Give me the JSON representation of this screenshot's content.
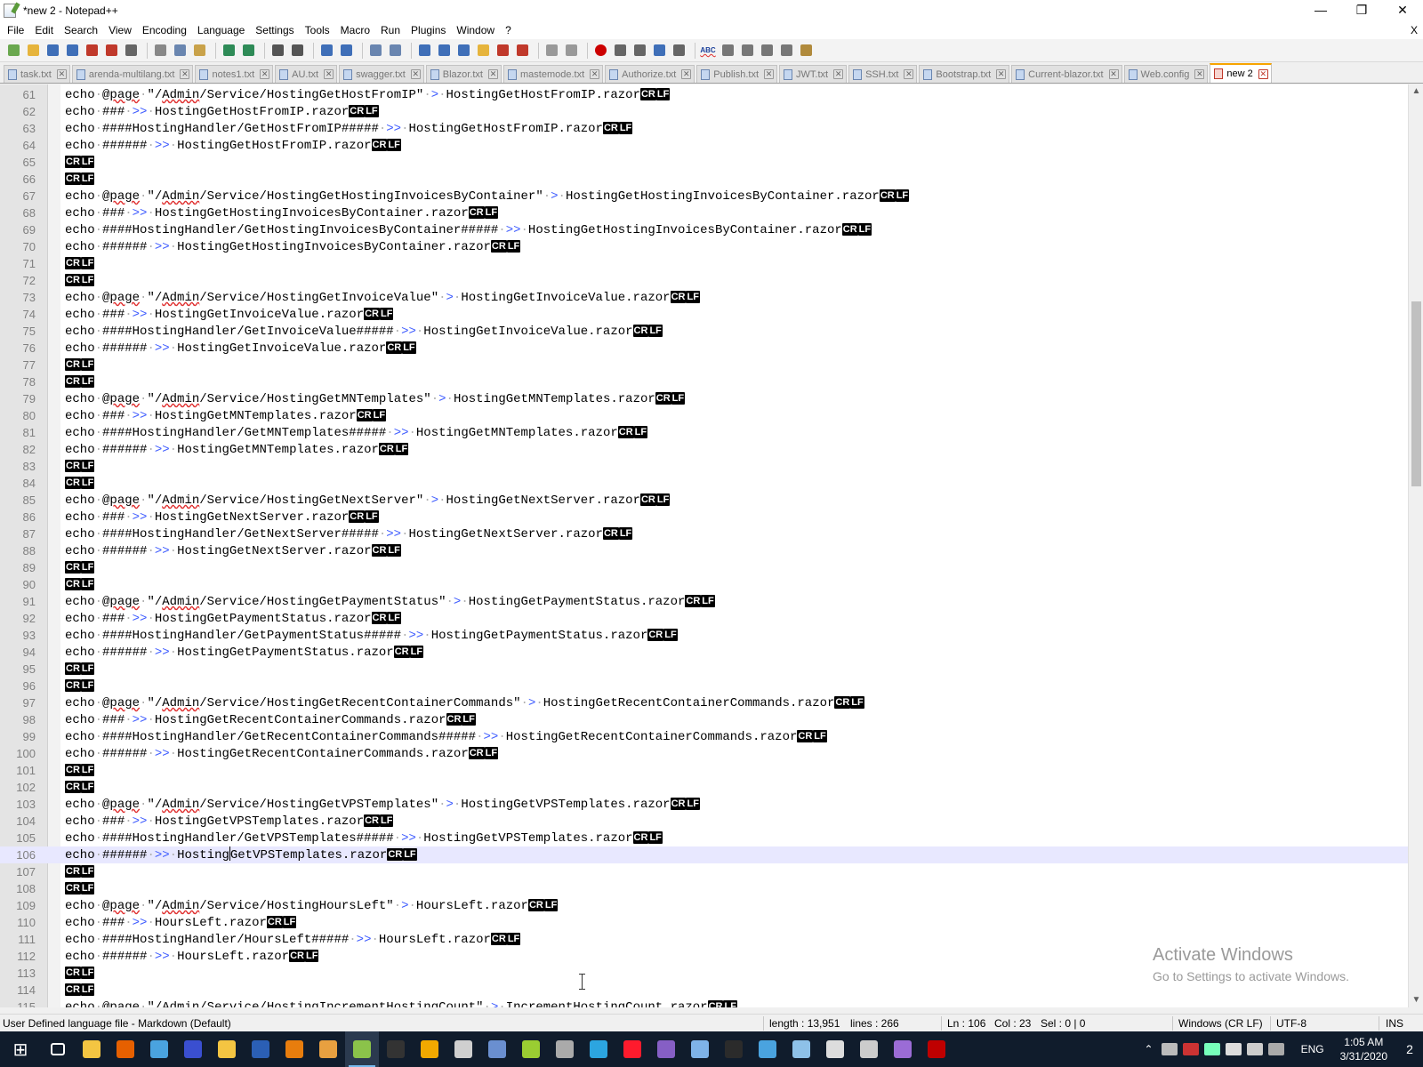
{
  "window": {
    "title": "*new 2 - Notepad++"
  },
  "menu": [
    "File",
    "Edit",
    "Search",
    "View",
    "Encoding",
    "Language",
    "Settings",
    "Tools",
    "Macro",
    "Run",
    "Plugins",
    "Window",
    "?"
  ],
  "menu_close": "X",
  "toolbar_icons": [
    "new-file-icon",
    "open-file-icon",
    "save-icon",
    "save-all-icon",
    "close-icon",
    "close-all-icon",
    "print-icon",
    "cut-icon",
    "copy-icon",
    "paste-icon",
    "undo-icon",
    "redo-icon",
    "find-icon",
    "replace-icon",
    "zoom-in-icon",
    "zoom-out-icon",
    "sync-vertical-icon",
    "sync-horizontal-icon",
    "word-wrap-icon",
    "show-all-chars-icon",
    "indent-guide-icon",
    "udl-icon",
    "doc-map-icon",
    "function-list-icon",
    "folder-workspace-icon",
    "monitoring-icon",
    "record-macro-icon",
    "stop-macro-icon",
    "play-macro-icon",
    "run-macro-multiple-icon",
    "save-macro-icon",
    "spell-check-icon",
    "nav-first-icon",
    "nav-back-icon",
    "nav-forward-icon",
    "nav-last-icon",
    "clipboard-icon"
  ],
  "toolbar_spell_label": "ABC",
  "tabs": [
    {
      "label": "task.txt",
      "active": false
    },
    {
      "label": "arenda-multilang.txt",
      "active": false
    },
    {
      "label": "notes1.txt",
      "active": false
    },
    {
      "label": "AU.txt",
      "active": false
    },
    {
      "label": "swagger.txt",
      "active": false
    },
    {
      "label": "Blazor.txt",
      "active": false
    },
    {
      "label": "mastemode.txt",
      "active": false
    },
    {
      "label": "Authorize.txt",
      "active": false
    },
    {
      "label": "Publish.txt",
      "active": false
    },
    {
      "label": "JWT.txt",
      "active": false
    },
    {
      "label": "SSH.txt",
      "active": false
    },
    {
      "label": "Bootstrap.txt",
      "active": false
    },
    {
      "label": "Current-blazor.txt",
      "active": false
    },
    {
      "label": "Web.config",
      "active": false
    },
    {
      "label": "new 2",
      "active": true
    }
  ],
  "editor": {
    "eol_cr": "CR",
    "eol_lf": "LF",
    "current_line": 106,
    "caret_line": 106,
    "caret_col": 23,
    "lines": [
      {
        "n": "61",
        "t": "echo @page \"/Admin/Service/HostingGetHostFromIP\" > HostingGetHostFromIP.razor"
      },
      {
        "n": "62",
        "t": "echo ### >> HostingGetHostFromIP.razor"
      },
      {
        "n": "63",
        "t": "echo ####HostingHandler/GetHostFromIP##### >> HostingGetHostFromIP.razor"
      },
      {
        "n": "64",
        "t": "echo ###### >> HostingGetHostFromIP.razor"
      },
      {
        "n": "65",
        "t": ""
      },
      {
        "n": "66",
        "t": ""
      },
      {
        "n": "67",
        "t": "echo @page \"/Admin/Service/HostingGetHostingInvoicesByContainer\" > HostingGetHostingInvoicesByContainer.razor"
      },
      {
        "n": "68",
        "t": "echo ### >> HostingGetHostingInvoicesByContainer.razor"
      },
      {
        "n": "69",
        "t": "echo ####HostingHandler/GetHostingInvoicesByContainer##### >> HostingGetHostingInvoicesByContainer.razor"
      },
      {
        "n": "70",
        "t": "echo ###### >> HostingGetHostingInvoicesByContainer.razor"
      },
      {
        "n": "71",
        "t": ""
      },
      {
        "n": "72",
        "t": ""
      },
      {
        "n": "73",
        "t": "echo @page \"/Admin/Service/HostingGetInvoiceValue\" > HostingGetInvoiceValue.razor"
      },
      {
        "n": "74",
        "t": "echo ### >> HostingGetInvoiceValue.razor"
      },
      {
        "n": "75",
        "t": "echo ####HostingHandler/GetInvoiceValue##### >> HostingGetInvoiceValue.razor"
      },
      {
        "n": "76",
        "t": "echo ###### >> HostingGetInvoiceValue.razor"
      },
      {
        "n": "77",
        "t": ""
      },
      {
        "n": "78",
        "t": ""
      },
      {
        "n": "79",
        "t": "echo @page \"/Admin/Service/HostingGetMNTemplates\" > HostingGetMNTemplates.razor"
      },
      {
        "n": "80",
        "t": "echo ### >> HostingGetMNTemplates.razor"
      },
      {
        "n": "81",
        "t": "echo ####HostingHandler/GetMNTemplates##### >> HostingGetMNTemplates.razor"
      },
      {
        "n": "82",
        "t": "echo ###### >> HostingGetMNTemplates.razor"
      },
      {
        "n": "83",
        "t": ""
      },
      {
        "n": "84",
        "t": ""
      },
      {
        "n": "85",
        "t": "echo @page \"/Admin/Service/HostingGetNextServer\" > HostingGetNextServer.razor"
      },
      {
        "n": "86",
        "t": "echo ### >> HostingGetNextServer.razor"
      },
      {
        "n": "87",
        "t": "echo ####HostingHandler/GetNextServer##### >> HostingGetNextServer.razor"
      },
      {
        "n": "88",
        "t": "echo ###### >> HostingGetNextServer.razor"
      },
      {
        "n": "89",
        "t": ""
      },
      {
        "n": "90",
        "t": ""
      },
      {
        "n": "91",
        "t": "echo @page \"/Admin/Service/HostingGetPaymentStatus\" > HostingGetPaymentStatus.razor"
      },
      {
        "n": "92",
        "t": "echo ### >> HostingGetPaymentStatus.razor"
      },
      {
        "n": "93",
        "t": "echo ####HostingHandler/GetPaymentStatus##### >> HostingGetPaymentStatus.razor"
      },
      {
        "n": "94",
        "t": "echo ###### >> HostingGetPaymentStatus.razor"
      },
      {
        "n": "95",
        "t": ""
      },
      {
        "n": "96",
        "t": ""
      },
      {
        "n": "97",
        "t": "echo @page \"/Admin/Service/HostingGetRecentContainerCommands\" > HostingGetRecentContainerCommands.razor"
      },
      {
        "n": "98",
        "t": "echo ### >> HostingGetRecentContainerCommands.razor"
      },
      {
        "n": "99",
        "t": "echo ####HostingHandler/GetRecentContainerCommands##### >> HostingGetRecentContainerCommands.razor"
      },
      {
        "n": "100",
        "t": "echo ###### >> HostingGetRecentContainerCommands.razor"
      },
      {
        "n": "101",
        "t": ""
      },
      {
        "n": "102",
        "t": ""
      },
      {
        "n": "103",
        "t": "echo @page \"/Admin/Service/HostingGetVPSTemplates\" > HostingGetVPSTemplates.razor"
      },
      {
        "n": "104",
        "t": "echo ### >> HostingGetVPSTemplates.razor"
      },
      {
        "n": "105",
        "t": "echo ####HostingHandler/GetVPSTemplates##### >> HostingGetVPSTemplates.razor"
      },
      {
        "n": "106",
        "t": "echo ###### >> HostingGetVPSTemplates.razor"
      },
      {
        "n": "107",
        "t": ""
      },
      {
        "n": "108",
        "t": ""
      },
      {
        "n": "109",
        "t": "echo @page \"/Admin/Service/HostingHoursLeft\" > HoursLeft.razor"
      },
      {
        "n": "110",
        "t": "echo ### >> HoursLeft.razor"
      },
      {
        "n": "111",
        "t": "echo ####HostingHandler/HoursLeft##### >> HoursLeft.razor"
      },
      {
        "n": "112",
        "t": "echo ###### >> HoursLeft.razor"
      },
      {
        "n": "113",
        "t": ""
      },
      {
        "n": "114",
        "t": ""
      },
      {
        "n": "115",
        "t": "echo @page \"/Admin/Service/HostingIncrementHostingCount\" > IncrementHostingCount.razor"
      }
    ]
  },
  "watermark": {
    "line1": "Activate Windows",
    "line2": "Go to Settings to activate Windows."
  },
  "status": {
    "language": "User Defined language file - Markdown (Default)",
    "length": "length : 13,951",
    "lines": "lines : 266",
    "ln": "Ln : 106",
    "col": "Col : 23",
    "sel": "Sel : 0 | 0",
    "eol": "Windows (CR LF)",
    "encoding": "UTF-8",
    "mode": "INS"
  },
  "taskbar": {
    "apps": [
      {
        "name": "start-icon",
        "color": "#ffffff"
      },
      {
        "name": "task-view-icon",
        "color": "#ffffff"
      },
      {
        "name": "file-explorer-icon",
        "color": "#f4c542"
      },
      {
        "name": "firefox-icon",
        "color": "#e66000"
      },
      {
        "name": "chrome-icon",
        "color": "#4aa3df"
      },
      {
        "name": "app-icon",
        "color": "#3a4fd0"
      },
      {
        "name": "folder-icon",
        "color": "#f4c542"
      },
      {
        "name": "photoshop-icon",
        "color": "#2b5fb5"
      },
      {
        "name": "blender-icon",
        "color": "#e87d0d"
      },
      {
        "name": "app-icon",
        "color": "#e8a040"
      },
      {
        "name": "notepadpp-icon",
        "color": "#8bc34a"
      },
      {
        "name": "terminal-icon",
        "color": "#333333"
      },
      {
        "name": "app-icon",
        "color": "#f2a900"
      },
      {
        "name": "tools-icon",
        "color": "#cfcfcf"
      },
      {
        "name": "app-icon",
        "color": "#6a8fd0"
      },
      {
        "name": "app-icon",
        "color": "#9acd32"
      },
      {
        "name": "app-icon",
        "color": "#aaaaaa"
      },
      {
        "name": "telegram-icon",
        "color": "#2ca5e0"
      },
      {
        "name": "opera-icon",
        "color": "#ff1b2d"
      },
      {
        "name": "visual-studio-icon",
        "color": "#865fc5"
      },
      {
        "name": "app-icon",
        "color": "#7fb3e8"
      },
      {
        "name": "rider-icon",
        "color": "#2b2b2b"
      },
      {
        "name": "app-icon",
        "color": "#4aa3df"
      },
      {
        "name": "app-icon",
        "color": "#8ec1e8"
      },
      {
        "name": "app-icon",
        "color": "#dddddd"
      },
      {
        "name": "app-icon",
        "color": "#cccccc"
      },
      {
        "name": "visual-studio-icon",
        "color": "#9b6cd6"
      },
      {
        "name": "filezilla-icon",
        "color": "#bf0000"
      }
    ],
    "start_glyph": "⊞",
    "lang": "ENG",
    "time": "1:05 AM",
    "date": "3/31/2020",
    "notifications": "2"
  }
}
